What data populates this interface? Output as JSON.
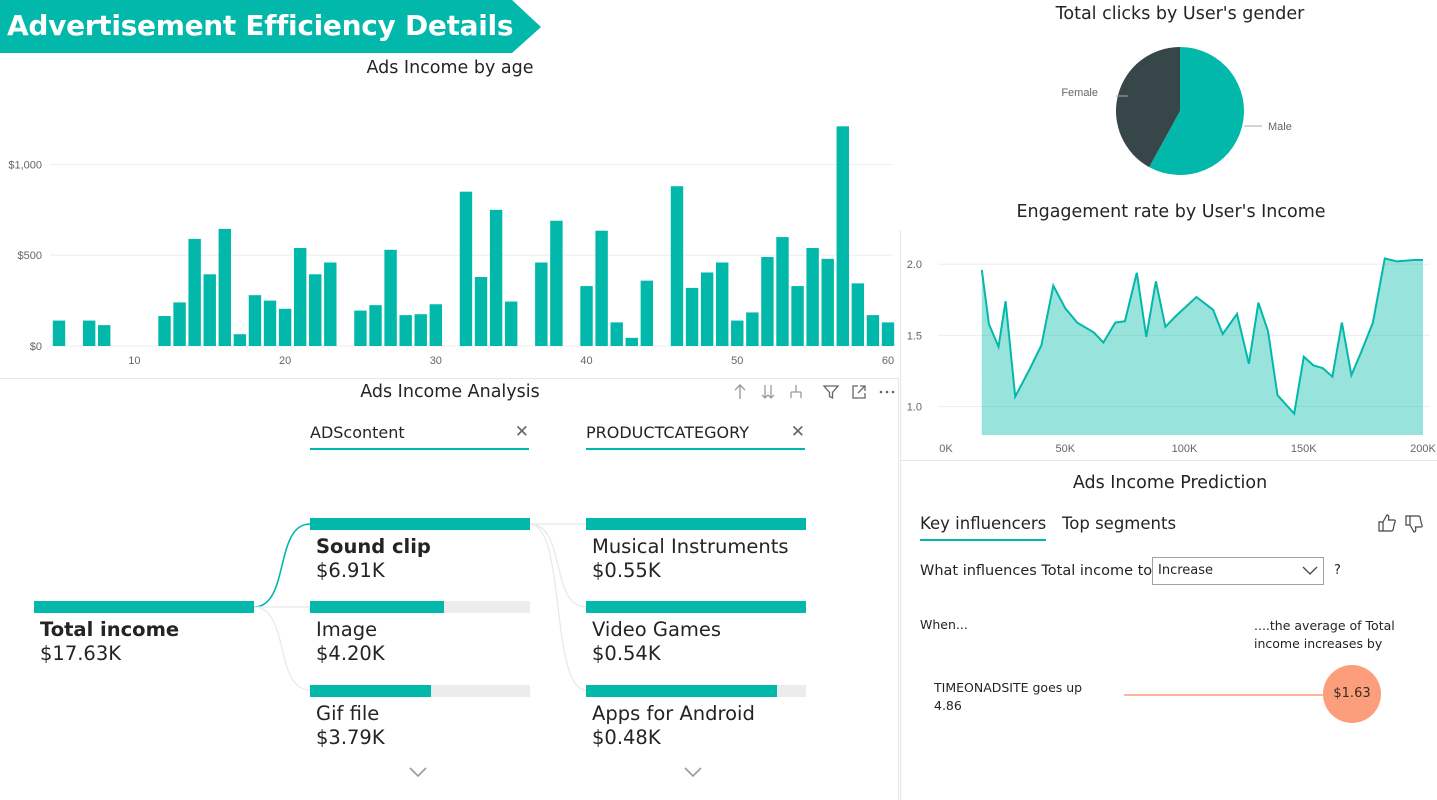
{
  "banner": {
    "title": "Advertisement Efficiency Details",
    "color": "#01b8aa"
  },
  "accent_color": "#01b8aa",
  "age_chart": {
    "title": "Ads Income by age",
    "chart_data": {
      "type": "bar",
      "x": [
        5,
        6,
        7,
        8,
        9,
        10,
        11,
        12,
        13,
        14,
        15,
        16,
        17,
        18,
        19,
        20,
        21,
        22,
        23,
        24,
        25,
        26,
        27,
        28,
        29,
        30,
        31,
        32,
        33,
        34,
        35,
        36,
        37,
        38,
        39,
        40,
        41,
        42,
        43,
        44,
        45,
        46,
        47,
        48,
        49,
        50,
        51,
        52,
        53,
        54,
        55,
        56,
        57,
        58,
        59,
        60
      ],
      "values": [
        140,
        0,
        140,
        115,
        0,
        0,
        0,
        165,
        240,
        590,
        395,
        645,
        65,
        280,
        250,
        205,
        540,
        395,
        460,
        0,
        195,
        225,
        530,
        170,
        175,
        230,
        0,
        850,
        380,
        750,
        245,
        0,
        460,
        690,
        0,
        330,
        635,
        130,
        45,
        360,
        0,
        880,
        320,
        405,
        460,
        140,
        185,
        490,
        600,
        330,
        540,
        480,
        1210,
        345,
        170,
        130
      ],
      "ylim": [
        0,
        1300
      ],
      "yticks": [
        "$0",
        "$500",
        "$1,000"
      ],
      "xticks": [
        "10",
        "20",
        "30",
        "40",
        "50",
        "60"
      ],
      "grid": true
    }
  },
  "gender_chart": {
    "title": "Total clicks by User's gender",
    "chart_data": {
      "type": "pie",
      "labels": [
        "Female",
        "Male"
      ],
      "values": [
        42,
        58
      ],
      "colors": [
        "#374649",
        "#01b8aa"
      ]
    }
  },
  "engagement_chart": {
    "title": "Engagement rate by User's Income",
    "chart_data": {
      "type": "area",
      "x": [
        15,
        18,
        22,
        25,
        29,
        35,
        40,
        45,
        50,
        55,
        62,
        66,
        71,
        75,
        80,
        84,
        88,
        92,
        96,
        105,
        112,
        116,
        122,
        127,
        131,
        135,
        139,
        146,
        150,
        154,
        158,
        162,
        166,
        170,
        174,
        179,
        184,
        189,
        196,
        200
      ],
      "values": [
        1.96,
        1.58,
        1.42,
        1.74,
        1.07,
        1.26,
        1.43,
        1.85,
        1.69,
        1.59,
        1.52,
        1.45,
        1.59,
        1.6,
        1.94,
        1.49,
        1.88,
        1.56,
        1.63,
        1.77,
        1.68,
        1.51,
        1.65,
        1.3,
        1.73,
        1.53,
        1.08,
        0.95,
        1.35,
        1.29,
        1.27,
        1.21,
        1.59,
        1.22,
        1.38,
        1.59,
        2.04,
        2.02,
        2.03,
        2.03
      ],
      "xlim": [
        0,
        200
      ],
      "ylim": [
        0.8,
        2.1
      ],
      "xticks": [
        "0K",
        "50K",
        "100K",
        "150K",
        "200K"
      ],
      "yticks": [
        "1.0",
        "1.5",
        "2.0"
      ]
    }
  },
  "decomp": {
    "title": "Ads Income Analysis",
    "fields": [
      {
        "label": "ADScontent"
      },
      {
        "label": "PRODUCTCATEGORY"
      }
    ],
    "root": {
      "name": "Total income",
      "value": "$17.63K"
    },
    "level1": [
      {
        "name": "Sound clip",
        "value": "$6.91K",
        "fraction": 1.0
      },
      {
        "name": "Image",
        "value": "$4.20K",
        "fraction": 0.61
      },
      {
        "name": "Gif file",
        "value": "$3.79K",
        "fraction": 0.55
      }
    ],
    "level2": [
      {
        "name": "Musical Instruments",
        "value": "$0.55K",
        "fraction": 1.0
      },
      {
        "name": "Video Games",
        "value": "$0.54K",
        "fraction": 1.0
      },
      {
        "name": "Apps for Android",
        "value": "$0.48K",
        "fraction": 0.87
      }
    ]
  },
  "prediction": {
    "title": "Ads Income Prediction",
    "tabs": [
      "Key influencers",
      "Top segments"
    ],
    "question": "What influences Total income to",
    "select_value": "Increase",
    "help": "?",
    "when_label": "When...",
    "average_label": "....the average of Total income increases by",
    "influencer": {
      "line1": "TIMEONADSITE goes up",
      "line2": "4.86",
      "value": "$1.63",
      "color": "#fc9e7b"
    }
  }
}
